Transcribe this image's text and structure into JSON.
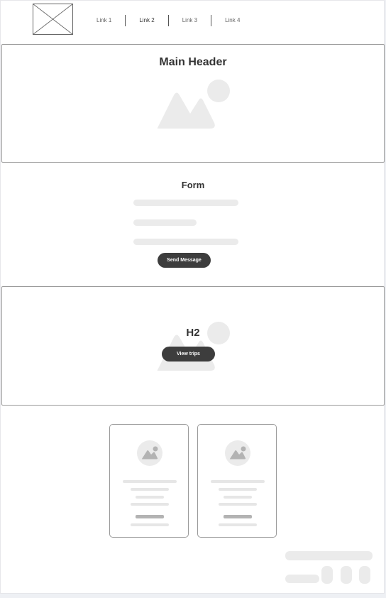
{
  "nav": {
    "links": [
      {
        "label": "Link 1"
      },
      {
        "label": "Link 2"
      },
      {
        "label": "Link 3"
      },
      {
        "label": "Link 4"
      }
    ],
    "active_index": 1
  },
  "hero": {
    "title": "Main Header"
  },
  "form": {
    "title": "Form",
    "button_label": "Send Message"
  },
  "banner": {
    "title": "H2",
    "button_label": "View trips"
  },
  "cards": [
    {
      "image": "image-placeholder-icon"
    },
    {
      "image": "image-placeholder-icon"
    }
  ],
  "icons": {
    "logo": "logo-placeholder-icon",
    "image": "image-placeholder-icon"
  },
  "colors": {
    "button": "#3d3d3d",
    "placeholder": "#ebebeb",
    "border": "#9a9a9a"
  }
}
